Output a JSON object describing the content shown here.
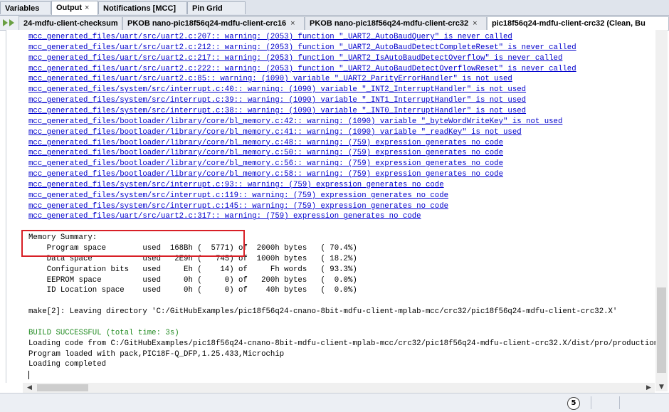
{
  "top_tabs": [
    {
      "label": "Variables"
    },
    {
      "label": "Output",
      "close": "×"
    },
    {
      "label": "Notifications [MCC]"
    },
    {
      "label": "Pin Grid View"
    }
  ],
  "sub_tabs": [
    {
      "label": "24-mdfu-client-checksum",
      "close": "×"
    },
    {
      "label": "PKOB nano-pic18f56q24-mdfu-client-crc16",
      "close": "×"
    },
    {
      "label": "PKOB nano-pic18f56q24-mdfu-client-crc32",
      "close": "×"
    },
    {
      "label": "pic18f56q24-mdfu-client-crc32 (Clean, Bu"
    }
  ],
  "console_lines": [
    {
      "text": "mcc_generated_files/uart/src/uart2.c:207:: warning: (2053) function \"_UART2_AutoBaudQuery\" is never called",
      "style": "link"
    },
    {
      "text": "mcc_generated_files/uart/src/uart2.c:212:: warning: (2053) function \"_UART2_AutoBaudDetectCompleteReset\" is never called",
      "style": "link"
    },
    {
      "text": "mcc_generated_files/uart/src/uart2.c:217:: warning: (2053) function \"_UART2_IsAutoBaudDetectOverflow\" is never called",
      "style": "link"
    },
    {
      "text": "mcc_generated_files/uart/src/uart2.c:222:: warning: (2053) function \"_UART2_AutoBaudDetectOverflowReset\" is never called",
      "style": "link"
    },
    {
      "text": "mcc_generated_files/uart/src/uart2.c:85:: warning: (1090) variable \"_UART2_ParityErrorHandler\" is not used",
      "style": "link"
    },
    {
      "text": "mcc_generated_files/system/src/interrupt.c:40:: warning: (1090) variable \"_INT2_InterruptHandler\" is not used",
      "style": "link"
    },
    {
      "text": "mcc_generated_files/system/src/interrupt.c:39:: warning: (1090) variable \"_INT1_InterruptHandler\" is not used",
      "style": "link"
    },
    {
      "text": "mcc_generated_files/system/src/interrupt.c:38:: warning: (1090) variable \"_INT0_InterruptHandler\" is not used",
      "style": "link"
    },
    {
      "text": "mcc_generated_files/bootloader/library/core/bl_memory.c:42:: warning: (1090) variable \"_byteWordWriteKey\" is not used",
      "style": "link"
    },
    {
      "text": "mcc_generated_files/bootloader/library/core/bl_memory.c:41:: warning: (1090) variable \"_readKey\" is not used",
      "style": "link"
    },
    {
      "text": "mcc_generated_files/bootloader/library/core/bl_memory.c:48:: warning: (759) expression generates no code",
      "style": "link"
    },
    {
      "text": "mcc_generated_files/bootloader/library/core/bl_memory.c:50:: warning: (759) expression generates no code",
      "style": "link"
    },
    {
      "text": "mcc_generated_files/bootloader/library/core/bl_memory.c:56:: warning: (759) expression generates no code",
      "style": "link"
    },
    {
      "text": "mcc_generated_files/bootloader/library/core/bl_memory.c:58:: warning: (759) expression generates no code",
      "style": "link"
    },
    {
      "text": "mcc_generated_files/system/src/interrupt.c:93:: warning: (759) expression generates no code",
      "style": "link"
    },
    {
      "text": "mcc_generated_files/system/src/interrupt.c:119:: warning: (759) expression generates no code",
      "style": "link"
    },
    {
      "text": "mcc_generated_files/system/src/interrupt.c:145:: warning: (759) expression generates no code",
      "style": "link"
    },
    {
      "text": "mcc_generated_files/uart/src/uart2.c:317:: warning: (759) expression generates no code",
      "style": "link"
    },
    {
      "text": "",
      "style": "plain"
    },
    {
      "text": "Memory Summary:",
      "style": "plain"
    },
    {
      "text": "    Program space        used  168Bh (  5771) of  2000h bytes   ( 70.4%)",
      "style": "plain"
    },
    {
      "text": "    Data space           used   2E9h (   745) of  1000h bytes   ( 18.2%)",
      "style": "plain"
    },
    {
      "text": "    Configuration bits   used     Eh (    14) of     Fh words   ( 93.3%)",
      "style": "plain"
    },
    {
      "text": "    EEPROM space         used     0h (     0) of   200h bytes   (  0.0%)",
      "style": "plain"
    },
    {
      "text": "    ID Location space    used     0h (     0) of    40h bytes   (  0.0%)",
      "style": "plain"
    },
    {
      "text": "",
      "style": "plain"
    },
    {
      "text": "make[2]: Leaving directory 'C:/GitHubExamples/pic18f56q24-cnano-8bit-mdfu-client-mplab-mcc/crc32/pic18f56q24-mdfu-client-crc32.X'",
      "style": "plain"
    },
    {
      "text": "",
      "style": "plain"
    },
    {
      "text": "BUILD SUCCESSFUL (total time: 3s)",
      "style": "green"
    },
    {
      "text": "Loading code from C:/GitHubExamples/pic18f56q24-cnano-8bit-mdfu-client-mplab-mcc/crc32/pic18f56q24-mdfu-client-crc32.X/dist/pro/production/",
      "style": "plain"
    },
    {
      "text": "Program loaded with pack,PIC18F-Q_DFP,1.25.433,Microchip",
      "style": "plain"
    },
    {
      "text": "Loading completed",
      "style": "plain"
    }
  ],
  "status": {
    "notification_count": "5"
  },
  "scroll": {
    "up_arrow": "▲",
    "down_arrow": "▼",
    "left_arrow": "◀",
    "right_arrow": "▶"
  }
}
